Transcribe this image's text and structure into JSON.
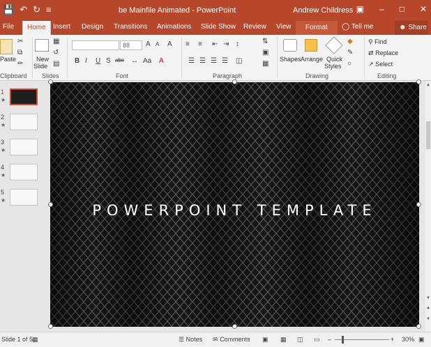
{
  "titlebar": {
    "title": "be Mainfile Animated  -  PowerPoint",
    "user": "Andrew Childress",
    "save_icon": "💾",
    "undo_icon": "↶",
    "redo_icon": "↻",
    "customize_icon": "≡",
    "restore_icon": "▣",
    "minimize_icon": "–",
    "maximize_icon": "□",
    "close_icon": "✕"
  },
  "tabs": {
    "file": "File",
    "home": "Home",
    "insert": "Insert",
    "design": "Design",
    "transitions": "Transitions",
    "animations": "Animations",
    "slideshow": "Slide Show",
    "review": "Review",
    "view": "View",
    "format": "Format",
    "tellme": "Tell me",
    "share": "Share"
  },
  "ribbon": {
    "clipboard": {
      "label": "Clipboard",
      "paste": "Paste"
    },
    "slides": {
      "label": "Slides",
      "new_slide_1": "New",
      "new_slide_2": "Slide"
    },
    "font": {
      "label": "Font",
      "font_name": "",
      "font_size": "88",
      "bold": "B",
      "italic": "I",
      "underline": "U",
      "strike": "S",
      "shadow": "abc",
      "grow": "A",
      "shrink": "A",
      "clear": "A"
    },
    "paragraph": {
      "label": "Paragraph"
    },
    "drawing": {
      "label": "Drawing",
      "shapes": "Shapes",
      "arrange": "Arrange",
      "quick_1": "Quick",
      "quick_2": "Styles"
    },
    "editing": {
      "label": "Editing",
      "find": "Find",
      "replace": "Replace",
      "select": "Select"
    }
  },
  "thumbnails": [
    {
      "num": "1",
      "star": "★"
    },
    {
      "num": "2",
      "star": "★"
    },
    {
      "num": "3",
      "star": "★"
    },
    {
      "num": "4",
      "star": "★"
    },
    {
      "num": "5",
      "star": "★"
    }
  ],
  "slide": {
    "title": "POWERPOINT TEMPLATE"
  },
  "statusbar": {
    "slide_info": "Slide 1 of 5",
    "notes": "Notes",
    "comments": "Comments",
    "zoom_minus": "–",
    "zoom_plus": "+",
    "zoom_level": "30%"
  },
  "colors": {
    "accent": "#b7472a",
    "selected_thumb_border": "#d24726"
  }
}
